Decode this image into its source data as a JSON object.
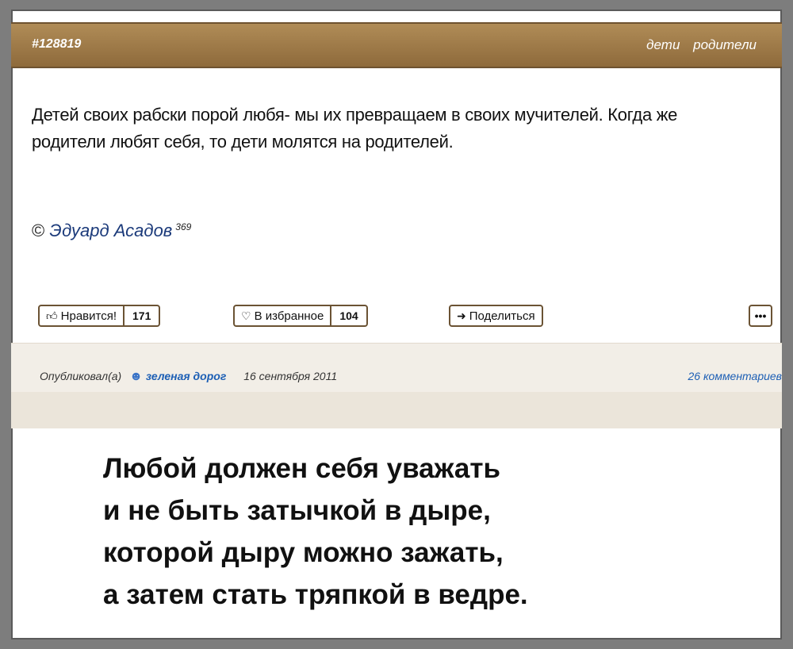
{
  "quote": {
    "id": "#128819",
    "tags": [
      "дети",
      "родители"
    ],
    "text": "Детей своих рабски порой любя- мы их превращаем в своих мучителей. Когда же родители любят себя, то дети молятся на родителей.",
    "author_prefix": "©",
    "author": "Эдуард Асадов",
    "author_count": "369"
  },
  "actions": {
    "like_label": "Нравится!",
    "like_icon": "thumbs-up-icon",
    "like_count": "171",
    "favorite_label": "В избранное",
    "favorite_icon": "heart-icon",
    "favorite_count": "104",
    "share_label": "Поделиться",
    "share_icon": "share-arrow-icon",
    "more_label": "•••"
  },
  "meta": {
    "published_label": "Опубликовал(а)",
    "username": "зеленая дорог",
    "date": "16 сентября 2011",
    "comments": "26 комментариев"
  },
  "poem": {
    "lines": [
      "Любой должен себя уважать",
      "и не быть затычкой в дыре,",
      "которой дыру можно зажать,",
      "а затем стать тряпкой в ведре."
    ]
  },
  "colors": {
    "header": "#9d7a48",
    "accent_link": "#1d5fb5",
    "button_border": "#6b5334"
  }
}
